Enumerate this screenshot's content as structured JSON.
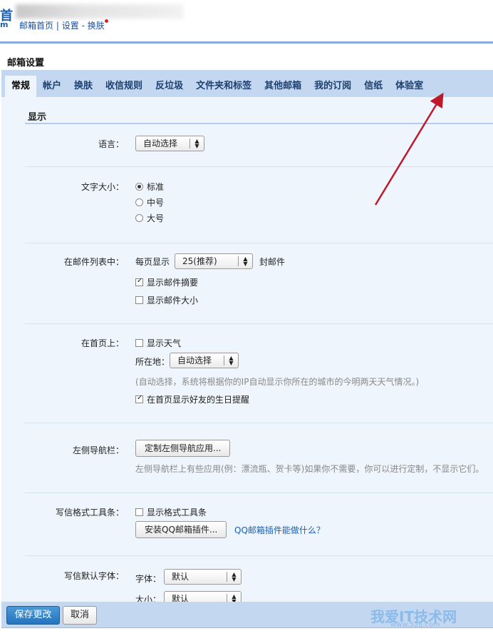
{
  "header": {
    "logo_char": "首",
    "logo_sub": "m",
    "links": [
      "邮箱首页",
      "设置",
      "换肤"
    ],
    "sep1": "|",
    "sep2": "-"
  },
  "page_title": "邮箱设置",
  "tabs": [
    "常规",
    "帐户",
    "换肤",
    "收信规则",
    "反垃圾",
    "文件夹和标签",
    "其他邮箱",
    "我的订阅",
    "信纸",
    "体验室"
  ],
  "section": "显示",
  "language": {
    "label": "语言：",
    "value": "自动选择"
  },
  "font_size": {
    "label": "文字大小：",
    "options": [
      "标准",
      "中号",
      "大号"
    ],
    "selected": 0
  },
  "mail_list": {
    "label": "在邮件列表中：",
    "per_page": "每页显示",
    "per_page_value": "25(推荐)",
    "unit": "封邮件",
    "show_summary": "显示邮件摘要",
    "show_size": "显示邮件大小",
    "summary_checked": true,
    "size_checked": false
  },
  "homepage": {
    "label": "在首页上：",
    "weather": "显示天气",
    "location_label": "所在地：",
    "location_value": "自动选择",
    "hint": "(自动选择，系统将根据你的IP自动显示你所在的城市的今明两天天气情况。)",
    "birthday": "在首页显示好友的生日提醒",
    "weather_checked": false,
    "birthday_checked": true
  },
  "leftnav": {
    "label": "左侧导航栏：",
    "button": "定制左侧导航应用...",
    "hint": "左侧导航栏上有些应用(例：漂流瓶、贺卡等)如果你不需要，你可以进行定制，不显示它们。"
  },
  "toolbar": {
    "label": "写信格式工具条：",
    "show": "显示格式工具条",
    "install": "安装QQ邮箱插件...",
    "link": "QQ邮箱插件能做什么？",
    "checked": false
  },
  "default_font": {
    "label": "写信默认字体：",
    "font_label": "字体：",
    "font_value": "默认",
    "size_label": "大小：",
    "size_value": "默认"
  },
  "footer": {
    "save": "保存更改",
    "cancel": "取消"
  },
  "watermark": {
    "text": "我爱IT技术网",
    "url": "www.52ij.com"
  },
  "colors": {
    "tab_bar": "#c3d8f0",
    "content": "#eff5fc",
    "arrow": "#c0172a"
  }
}
